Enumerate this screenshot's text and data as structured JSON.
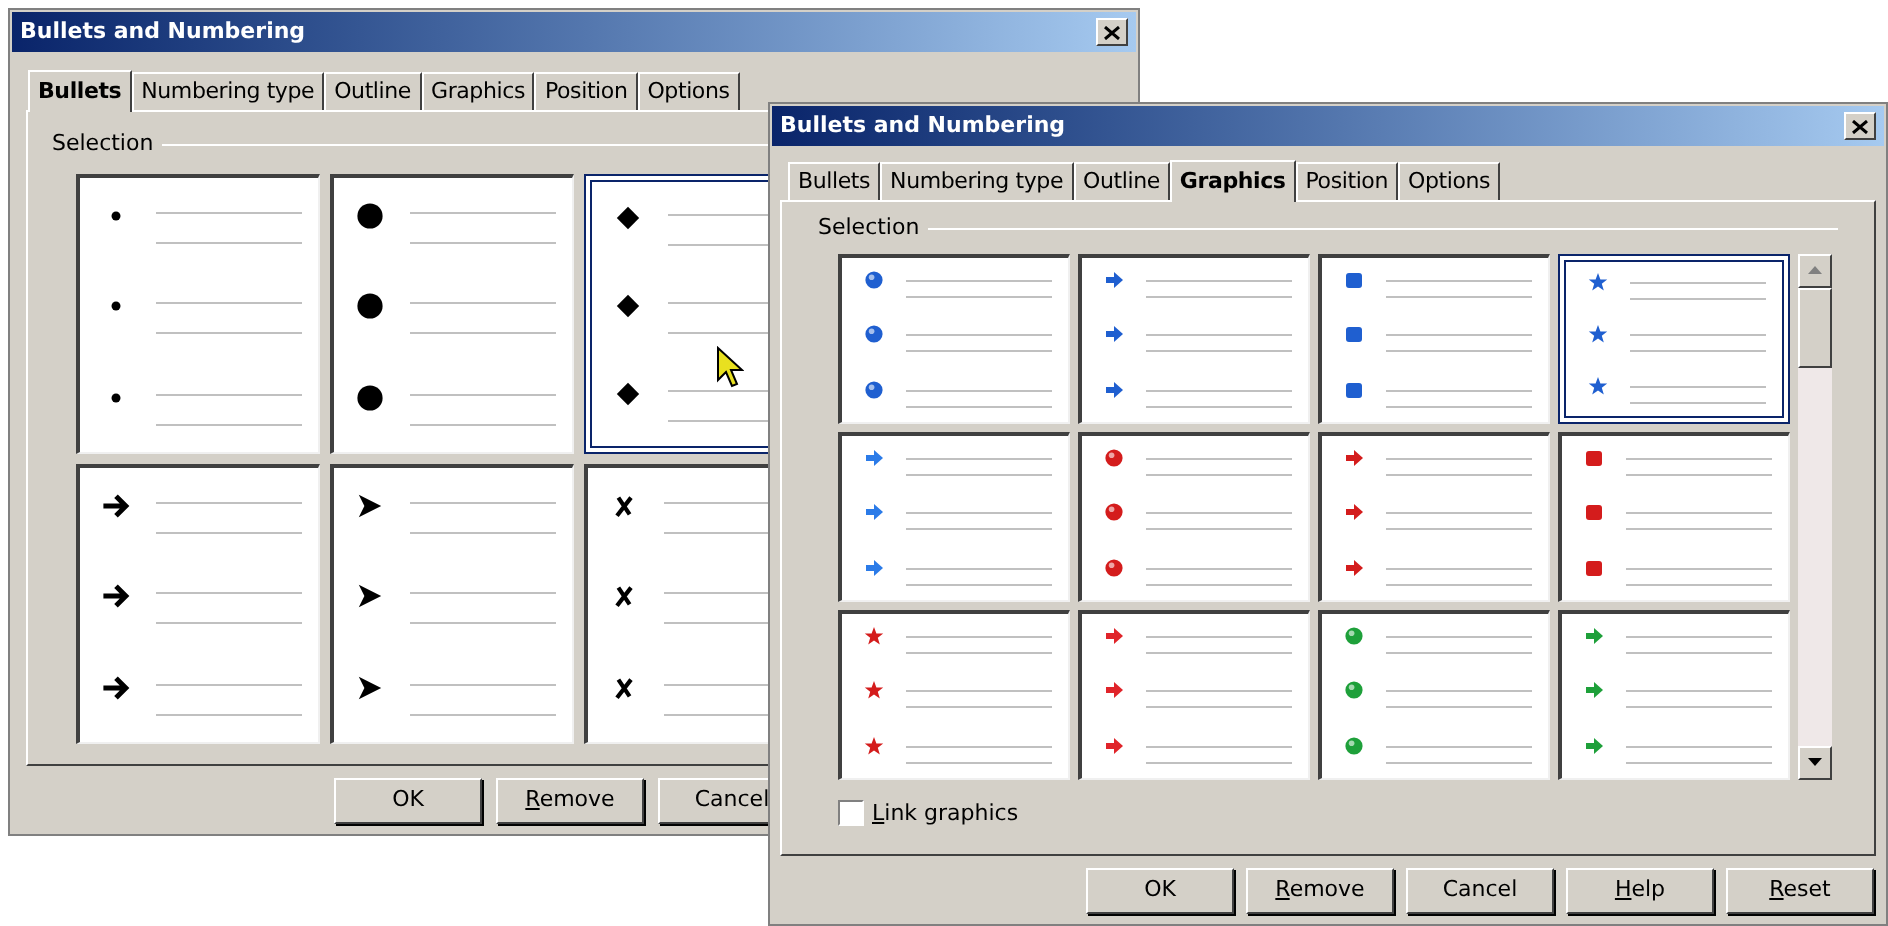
{
  "back_dialog": {
    "title": "Bullets and Numbering",
    "tabs": [
      {
        "label": "Bullets",
        "selected": true
      },
      {
        "label": "Numbering type",
        "selected": false
      },
      {
        "label": "Outline",
        "selected": false
      },
      {
        "label": "Graphics",
        "selected": false
      },
      {
        "label": "Position",
        "selected": false
      },
      {
        "label": "Options",
        "selected": false
      }
    ],
    "section_label": "Selection",
    "cells": [
      {
        "kind": "small-dot",
        "selected": false
      },
      {
        "kind": "big-dot",
        "selected": false
      },
      {
        "kind": "diamond",
        "selected": true
      },
      {
        "kind": "arrow",
        "selected": false
      },
      {
        "kind": "arrowhead",
        "selected": false
      },
      {
        "kind": "cross",
        "selected": false
      }
    ],
    "buttons": [
      {
        "label": "OK",
        "mnemonic": false
      },
      {
        "label": "Remove",
        "mnemonic": true
      },
      {
        "label": "Cancel",
        "mnemonic": false
      }
    ]
  },
  "front_dialog": {
    "title": "Bullets and Numbering",
    "tabs": [
      {
        "label": "Bullets",
        "selected": false
      },
      {
        "label": "Numbering type",
        "selected": false
      },
      {
        "label": "Outline",
        "selected": false
      },
      {
        "label": "Graphics",
        "selected": true
      },
      {
        "label": "Position",
        "selected": false
      },
      {
        "label": "Options",
        "selected": false
      }
    ],
    "section_label": "Selection",
    "cells": [
      {
        "kind": "sphere",
        "color": "#1f5fd0",
        "selected": false
      },
      {
        "kind": "arrow",
        "color": "#1f5fd0",
        "selected": false
      },
      {
        "kind": "square",
        "color": "#1f5fd0",
        "selected": false
      },
      {
        "kind": "star",
        "color": "#1f5fd0",
        "selected": true
      },
      {
        "kind": "arrow",
        "color": "#2b7be8",
        "selected": false
      },
      {
        "kind": "sphere",
        "color": "#d41c1c",
        "selected": false
      },
      {
        "kind": "arrow",
        "color": "#d41c1c",
        "selected": false
      },
      {
        "kind": "square",
        "color": "#d41c1c",
        "selected": false
      },
      {
        "kind": "star",
        "color": "#d41c1c",
        "selected": false
      },
      {
        "kind": "arrow",
        "color": "#e0242a",
        "selected": false
      },
      {
        "kind": "sphere",
        "color": "#1ea03a",
        "selected": false
      },
      {
        "kind": "arrow",
        "color": "#1ea03a",
        "selected": false
      }
    ],
    "link_graphics": {
      "label": "Link graphics",
      "checked": false,
      "mnemonic": true
    },
    "buttons": [
      {
        "label": "OK",
        "mnemonic": false
      },
      {
        "label": "Remove",
        "mnemonic": true
      },
      {
        "label": "Cancel",
        "mnemonic": false
      },
      {
        "label": "Help",
        "mnemonic": true
      },
      {
        "label": "Reset",
        "mnemonic": true
      }
    ]
  }
}
